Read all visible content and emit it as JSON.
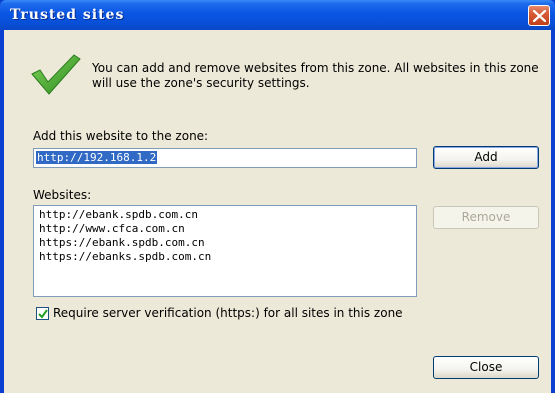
{
  "window": {
    "title": "Trusted sites"
  },
  "intro_text": "You can add and remove websites from this zone. All websites in this zone will use the zone's security settings.",
  "add_section": {
    "label": "Add this website to the zone:",
    "input_value": "http://192.168.1.2",
    "add_button": "Add"
  },
  "websites_section": {
    "label": "Websites:",
    "items": [
      "http://ebank.spdb.com.cn",
      "http://www.cfca.com.cn",
      "https://ebank.spdb.com.cn",
      "https://ebanks.spdb.com.cn"
    ],
    "remove_button": "Remove"
  },
  "verification": {
    "checked": true,
    "label": "Require server verification (https:) for all sites in this zone"
  },
  "close_button": "Close",
  "colors": {
    "titlebar": "#0a56e4",
    "client_bg": "#ece9d8",
    "selection": "#316ac5",
    "check_green": "#3aa52a"
  }
}
